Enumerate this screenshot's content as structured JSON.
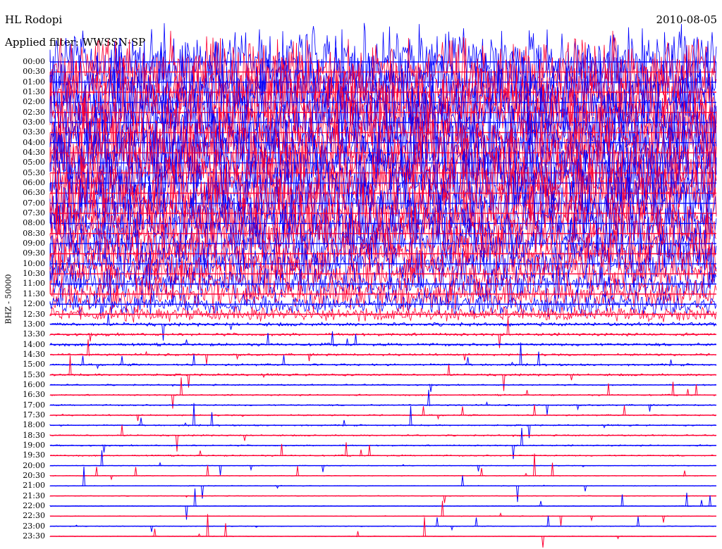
{
  "header": {
    "station": "HL Rodopi",
    "date": "2010-08-05",
    "filter_label": "Applied filter: WWSSN-SP"
  },
  "channel_label": "BHZ - 50000",
  "colors": {
    "trace_a": "#0000ff",
    "trace_b": "#ff0033",
    "background": "#ffffff",
    "text": "#000000"
  },
  "chart_data": {
    "type": "line",
    "title": "HL Rodopi",
    "subtitle": "Applied filter: WWSSN-SP",
    "date": "2010-08-05",
    "ylabel": "BHZ - 50000",
    "grid": false,
    "rows": [
      {
        "label": "00:00",
        "color": "blue",
        "amp": 1.0
      },
      {
        "label": "00:30",
        "color": "red",
        "amp": 1.0
      },
      {
        "label": "01:00",
        "color": "blue",
        "amp": 1.0
      },
      {
        "label": "01:30",
        "color": "red",
        "amp": 1.0
      },
      {
        "label": "02:00",
        "color": "blue",
        "amp": 1.0
      },
      {
        "label": "02:30",
        "color": "red",
        "amp": 1.0
      },
      {
        "label": "03:00",
        "color": "blue",
        "amp": 1.0
      },
      {
        "label": "03:30",
        "color": "red",
        "amp": 1.0
      },
      {
        "label": "04:00",
        "color": "blue",
        "amp": 1.0
      },
      {
        "label": "04:30",
        "color": "red",
        "amp": 1.0
      },
      {
        "label": "05:00",
        "color": "blue",
        "amp": 1.0
      },
      {
        "label": "05:30",
        "color": "red",
        "amp": 1.0
      },
      {
        "label": "06:00",
        "color": "blue",
        "amp": 1.0
      },
      {
        "label": "06:30",
        "color": "red",
        "amp": 1.0
      },
      {
        "label": "07:00",
        "color": "blue",
        "amp": 0.9
      },
      {
        "label": "07:30",
        "color": "red",
        "amp": 0.9
      },
      {
        "label": "08:00",
        "color": "blue",
        "amp": 0.8
      },
      {
        "label": "08:30",
        "color": "red",
        "amp": 0.8
      },
      {
        "label": "09:00",
        "color": "blue",
        "amp": 0.7
      },
      {
        "label": "09:30",
        "color": "red",
        "amp": 0.7
      },
      {
        "label": "10:00",
        "color": "blue",
        "amp": 0.6
      },
      {
        "label": "10:30",
        "color": "red",
        "amp": 0.6
      },
      {
        "label": "11:00",
        "color": "blue",
        "amp": 0.5
      },
      {
        "label": "11:30",
        "color": "red",
        "amp": 0.45
      },
      {
        "label": "12:00",
        "color": "blue",
        "amp": 0.35
      },
      {
        "label": "12:30",
        "color": "red",
        "amp": 0.2
      },
      {
        "label": "13:00",
        "color": "blue",
        "amp": 0.05
      },
      {
        "label": "13:30",
        "color": "red",
        "amp": 0.04
      },
      {
        "label": "14:00",
        "color": "blue",
        "amp": 0.04
      },
      {
        "label": "14:30",
        "color": "red",
        "amp": 0.03
      },
      {
        "label": "15:00",
        "color": "blue",
        "amp": 0.03
      },
      {
        "label": "15:30",
        "color": "red",
        "amp": 0.03
      },
      {
        "label": "16:00",
        "color": "blue",
        "amp": 0.02
      },
      {
        "label": "16:30",
        "color": "red",
        "amp": 0.02
      },
      {
        "label": "17:00",
        "color": "blue",
        "amp": 0.02
      },
      {
        "label": "17:30",
        "color": "red",
        "amp": 0.02
      },
      {
        "label": "18:00",
        "color": "blue",
        "amp": 0.02
      },
      {
        "label": "18:30",
        "color": "red",
        "amp": 0.02
      },
      {
        "label": "19:00",
        "color": "blue",
        "amp": 0.02
      },
      {
        "label": "19:30",
        "color": "red",
        "amp": 0.02
      },
      {
        "label": "20:00",
        "color": "blue",
        "amp": 0.01
      },
      {
        "label": "20:30",
        "color": "red",
        "amp": 0.01
      },
      {
        "label": "21:00",
        "color": "blue",
        "amp": 0.01
      },
      {
        "label": "21:30",
        "color": "red",
        "amp": 0.01
      },
      {
        "label": "22:00",
        "color": "blue",
        "amp": 0.01
      },
      {
        "label": "22:30",
        "color": "red",
        "amp": 0.01
      },
      {
        "label": "23:00",
        "color": "blue",
        "amp": 0.01
      },
      {
        "label": "23:30",
        "color": "red",
        "amp": 0.01
      }
    ]
  }
}
